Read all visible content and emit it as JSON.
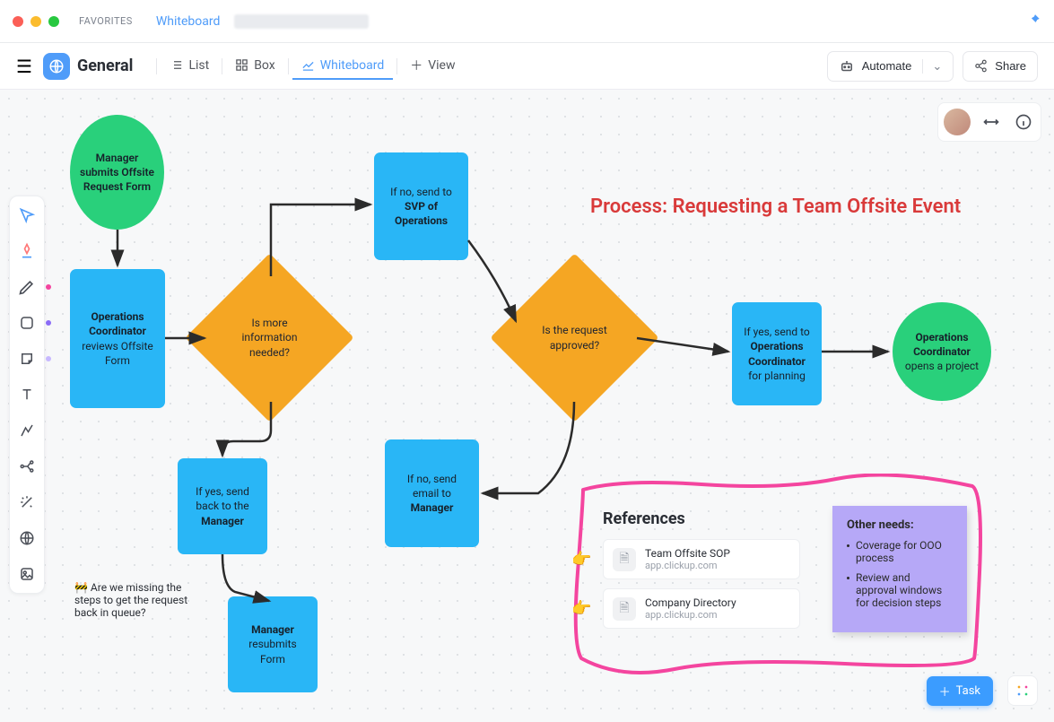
{
  "titlebar": {
    "favorites_label": "FAVORITES",
    "crumb": "Whiteboard"
  },
  "viewbar": {
    "space_title": "General",
    "tabs": {
      "list": "List",
      "box": "Box",
      "whiteboard": "Whiteboard",
      "addview": "View"
    },
    "automate": "Automate",
    "share": "Share"
  },
  "heading": "Process: Requesting a Team Offsite Event",
  "nodes": {
    "start": "Manager submits Offsite Request Form",
    "review_pre": "Operations Coordinator",
    "review_post": "reviews Offsite Form",
    "diamond1": "Is more information needed?",
    "svp_pre": "If no, send to",
    "svp_bold": "SVP of Operations",
    "backmgr_pre": "If yes, send back to the",
    "backmgr_bold": "Manager",
    "resubmit_pre": "Manager",
    "resubmit_post": "resubmits Form",
    "diamond2": "Is the request approved?",
    "email_pre": "If no, send email to",
    "email_bold": "Manager",
    "plan_pre": "If yes, send to",
    "plan_bold": "Operations Coordinator",
    "plan_post": "for planning",
    "end_pre": "Operations Coordinator",
    "end_post": "opens a project"
  },
  "comment": "🚧 Are we missing the steps to get the request back in queue?",
  "refs": {
    "title": "References",
    "items": [
      {
        "title": "Team Offsite SOP",
        "sub": "app.clickup.com"
      },
      {
        "title": "Company Directory",
        "sub": "app.clickup.com"
      }
    ]
  },
  "sticky": {
    "title": "Other needs:",
    "items": [
      "Coverage for OOO process",
      "Review and approval windows for decision steps"
    ]
  },
  "footer": {
    "task": "Task"
  }
}
